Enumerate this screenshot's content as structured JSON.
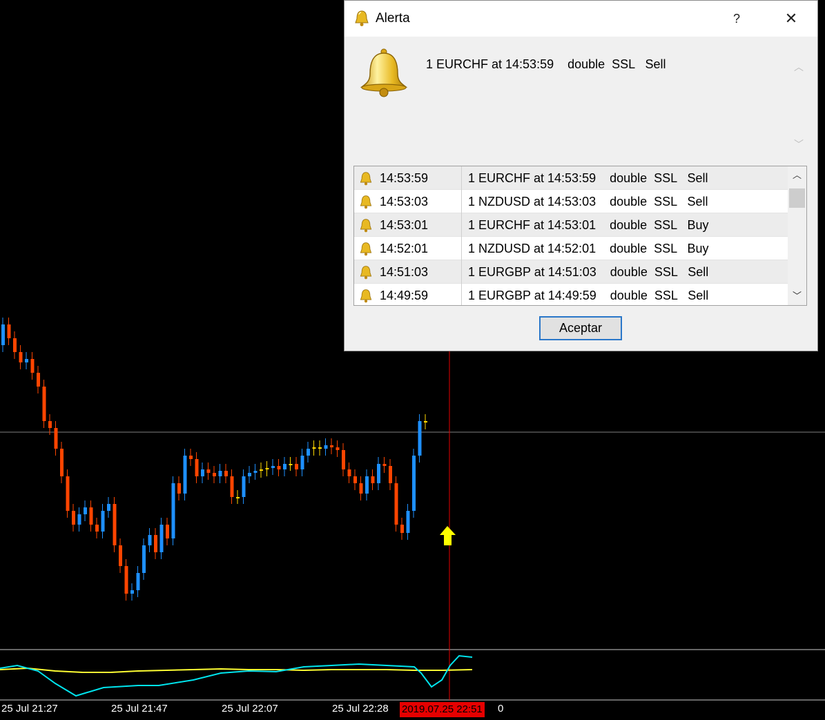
{
  "dialog": {
    "title": "Alerta",
    "help_label": "?",
    "close_label": "✕",
    "message": "1 EURCHF at 14:53:59    double  SSL   Sell",
    "ok_label": "Aceptar",
    "history": [
      {
        "time": "14:53:59",
        "message": "1 EURCHF at 14:53:59    double  SSL   Sell"
      },
      {
        "time": "14:53:03",
        "message": "1 NZDUSD at 14:53:03    double  SSL   Sell"
      },
      {
        "time": "14:53:01",
        "message": "1 EURCHF at 14:53:01    double  SSL   Buy"
      },
      {
        "time": "14:52:01",
        "message": "1 NZDUSD at 14:52:01    double  SSL   Buy"
      },
      {
        "time": "14:51:03",
        "message": "1 EURGBP at 14:51:03    double  SSL   Sell"
      },
      {
        "time": "14:49:59",
        "message": "1 EURGBP at 14:49:59    double  SSL   Sell"
      }
    ]
  },
  "chart": {
    "time_labels": [
      "25 Jul 21:27",
      "25 Jul 21:47",
      "25 Jul 22:07",
      "25 Jul 22:28"
    ],
    "cursor_time": "2019.07.25 22:51",
    "cursor_time_tail": "0",
    "colors": {
      "background": "#000000",
      "bull": "#1e90ff",
      "bear": "#ff4500",
      "doji": "#ffd700",
      "crosshair": "#e60000",
      "price_line": "#808080",
      "oscillator_fast": "#00e5ee",
      "oscillator_slow": "#ffff33",
      "signal_arrow": "#ffff00"
    }
  }
}
